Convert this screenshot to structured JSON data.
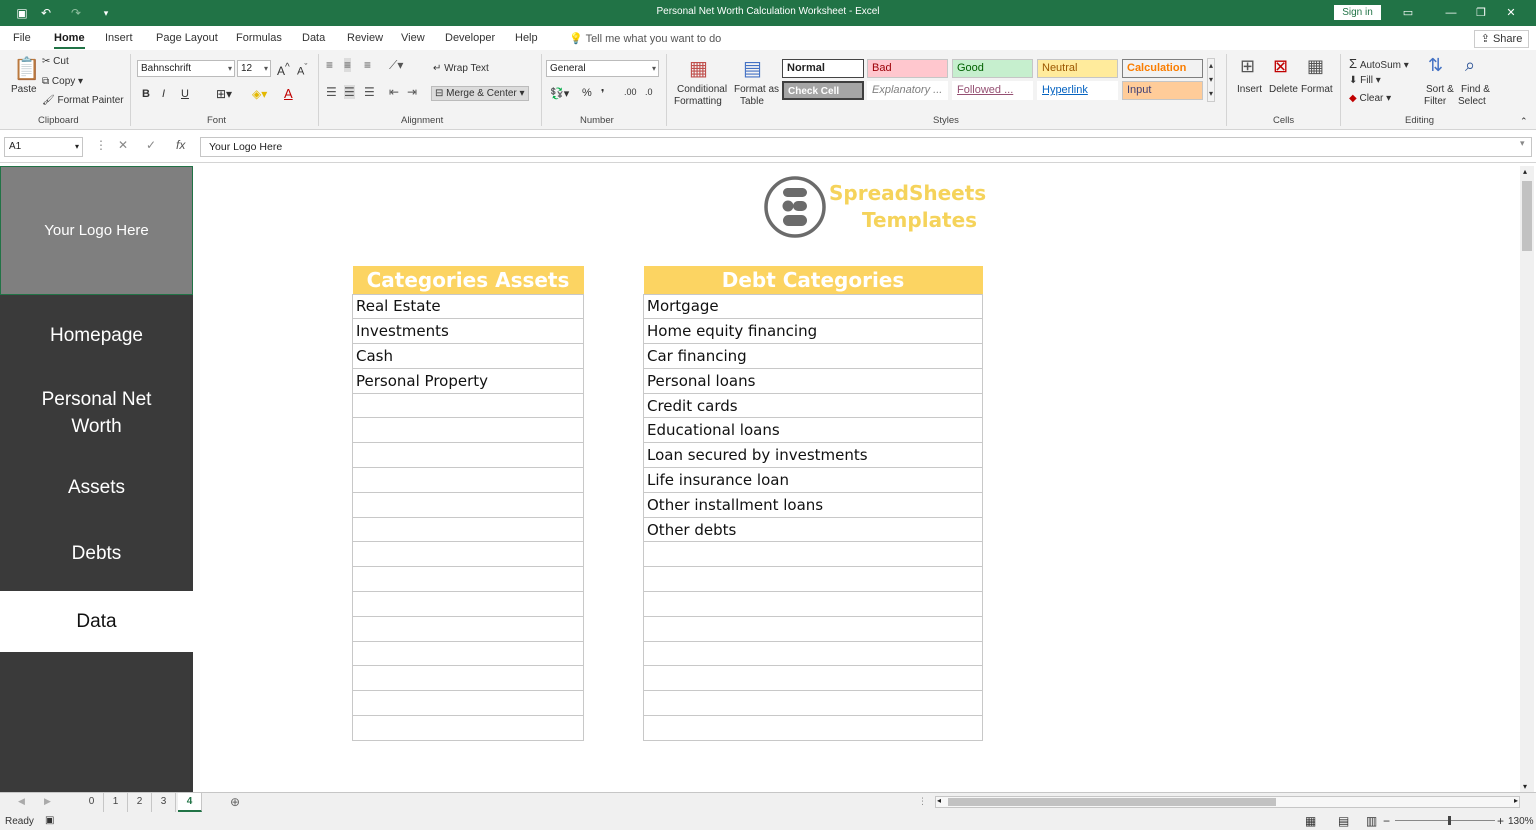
{
  "window": {
    "title": "Personal Net Worth Calculation Worksheet  -  Excel",
    "signin": "Sign in"
  },
  "menu": {
    "items": [
      "File",
      "Home",
      "Insert",
      "Page Layout",
      "Formulas",
      "Data",
      "Review",
      "View",
      "Developer",
      "Help"
    ],
    "tell_me": "Tell me what you want to do",
    "share": "Share"
  },
  "ribbon": {
    "clipboard": {
      "paste": "Paste",
      "cut": "Cut",
      "copy": "Copy",
      "format_painter": "Format Painter",
      "label": "Clipboard"
    },
    "font": {
      "name": "Bahnschrift",
      "size": "12",
      "label": "Font",
      "bold": "B",
      "italic": "I",
      "underline": "U"
    },
    "alignment": {
      "wrap": "Wrap Text",
      "merge": "Merge & Center",
      "label": "Alignment"
    },
    "number": {
      "format": "General",
      "label": "Number",
      "percent": "%"
    },
    "styles": {
      "conditional": "Conditional",
      "conditional2": "Formatting",
      "format_table": "Format as",
      "format_table2": "Table",
      "normal": "Normal",
      "bad": "Bad",
      "good": "Good",
      "neutral": "Neutral",
      "calculation": "Calculation",
      "check": "Check Cell",
      "explanatory": "Explanatory ...",
      "followed": "Followed ...",
      "hyperlink": "Hyperlink",
      "input": "Input",
      "label": "Styles"
    },
    "cells": {
      "insert": "Insert",
      "delete": "Delete",
      "format": "Format",
      "label": "Cells"
    },
    "editing": {
      "autosum": "AutoSum",
      "fill": "Fill",
      "clear": "Clear",
      "sort": "Sort &",
      "sort2": "Filter",
      "find": "Find &",
      "find2": "Select",
      "label": "Editing"
    }
  },
  "formula_bar": {
    "name_box": "A1",
    "content": "Your Logo Here"
  },
  "sidebar": {
    "logo": "Your Logo Here",
    "nav": [
      "Homepage",
      "Personal Net Worth",
      "Assets",
      "Debts",
      "Data"
    ]
  },
  "brand": {
    "line1": "SpreadSheets",
    "line2": "Templates"
  },
  "assets": {
    "header": "Categories Assets",
    "items": [
      "Real Estate",
      "Investments",
      "Cash",
      "Personal Property"
    ]
  },
  "debts": {
    "header": "Debt Categories",
    "items": [
      "Mortgage",
      "Home equity financing",
      "Car financing",
      "Personal loans",
      "Credit cards",
      "Educational loans",
      "Loan secured by investments",
      "Life insurance loan",
      "Other installment loans",
      "Other debts"
    ]
  },
  "sheets": {
    "tabs": [
      "0",
      "1",
      "2",
      "3",
      "4"
    ],
    "active": "4"
  },
  "status": {
    "ready": "Ready",
    "zoom": "130%"
  }
}
